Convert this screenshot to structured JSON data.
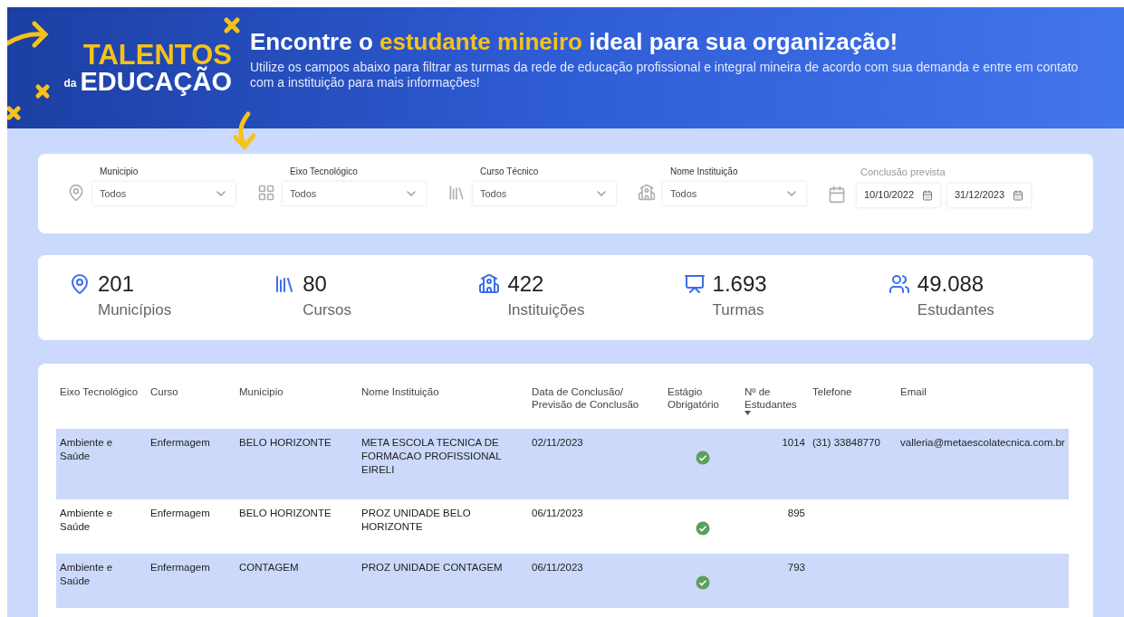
{
  "logo": {
    "top": "TALENTOS",
    "small": "da",
    "bottom": "EDUCAÇÃO"
  },
  "header": {
    "title": [
      {
        "text": "Encontre o ",
        "highlight": false
      },
      {
        "text": "estudante mineiro",
        "highlight": true
      },
      {
        "text": " ideal para sua organização!",
        "highlight": false
      }
    ],
    "subtitle": "Utilize os campos abaixo para filtrar as turmas da rede de educação profissional e integral mineira de acordo com sua demanda e entre em contato com a instituição para mais informações!"
  },
  "filters": [
    {
      "kind": "select",
      "label": "Municipio",
      "value": "Todos"
    },
    {
      "kind": "select",
      "label": "Eixo Tecnológico",
      "value": "Todos"
    },
    {
      "kind": "select",
      "label": "Curso Técnico",
      "value": "Todos"
    },
    {
      "kind": "select",
      "label": "Nome Instituição",
      "value": "Todos"
    },
    {
      "kind": "dates",
      "label": "Conclusão prevista",
      "from": "10/10/2022",
      "to": "31/12/2023"
    }
  ],
  "stats": [
    {
      "value": "201",
      "label": "Municípios"
    },
    {
      "value": "80",
      "label": "Cursos"
    },
    {
      "value": "422",
      "label": "Instituições"
    },
    {
      "value": "1.693",
      "label": "Turmas"
    },
    {
      "value": "49.088",
      "label": "Estudantes"
    }
  ],
  "table": {
    "columns": [
      {
        "label": "Eixo Tecnológico",
        "sorted": false
      },
      {
        "label": "Curso",
        "sorted": false
      },
      {
        "label": "Municipio",
        "sorted": false
      },
      {
        "label": "Nome Instituição",
        "sorted": false
      },
      {
        "label": "Data de Conclusão/ Previsão de Conclusão",
        "sorted": false
      },
      {
        "label": "Estágio Obrigatório",
        "sorted": false
      },
      {
        "label": "Nº de Estudantes",
        "sorted": true
      },
      {
        "label": "Telefone",
        "sorted": false
      },
      {
        "label": "Email",
        "sorted": false
      }
    ],
    "rows": [
      {
        "eixo": "Ambiente e Saúde",
        "curso": "Enfermagem",
        "municipio": "BELO HORIZONTE",
        "instituicao": "META ESCOLA TECNICA DE FORMACAO PROFISSIONAL EIRELI",
        "data": "02/11/2023",
        "estagio": true,
        "estudantes": "1014",
        "telefone": "(31) 33848770",
        "email": "valleria@metaescolatecnica.com.br"
      },
      {
        "eixo": "Ambiente e Saúde",
        "curso": "Enfermagem",
        "municipio": "BELO HORIZONTE",
        "instituicao": "PROZ UNIDADE BELO HORIZONTE",
        "data": "06/11/2023",
        "estagio": true,
        "estudantes": "895"
      },
      {
        "eixo": "Ambiente e Saúde",
        "curso": "Enfermagem",
        "municipio": "CONTAGEM",
        "instituicao": "PROZ UNIDADE CONTAGEM",
        "data": "06/11/2023",
        "estagio": true,
        "estudantes": "793"
      }
    ]
  }
}
